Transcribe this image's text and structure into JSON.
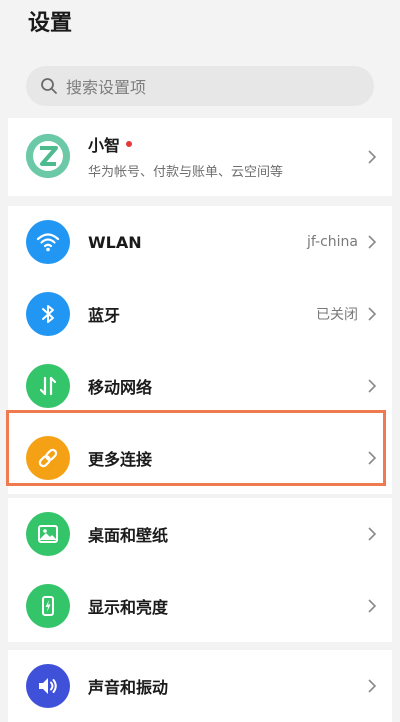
{
  "page": {
    "title": "设置"
  },
  "search": {
    "placeholder": "搜索设置项"
  },
  "account": {
    "name": "小智",
    "subtitle": "华为帐号、付款与账单、云空间等",
    "avatar_color": "#6cc9a8"
  },
  "network_group": [
    {
      "id": "wlan",
      "label": "WLAN",
      "value": "jf-china",
      "icon": "wifi-icon",
      "color": "#2196f3"
    },
    {
      "id": "bluetooth",
      "label": "蓝牙",
      "value": "已关闭",
      "icon": "bluetooth-icon",
      "color": "#2196f3"
    },
    {
      "id": "mobile-network",
      "label": "移动网络",
      "value": "",
      "icon": "mobile-data-icon",
      "color": "#34c46a"
    },
    {
      "id": "more-connections",
      "label": "更多连接",
      "value": "",
      "icon": "link-icon",
      "color": "#f5a116",
      "highlighted": true
    }
  ],
  "display_group": [
    {
      "id": "wallpaper",
      "label": "桌面和壁纸",
      "icon": "wallpaper-icon",
      "color": "#34c46a"
    },
    {
      "id": "display",
      "label": "显示和亮度",
      "icon": "phone-brightness-icon",
      "color": "#34c46a"
    }
  ],
  "sound_group": [
    {
      "id": "sound",
      "label": "声音和振动",
      "icon": "speaker-icon",
      "color": "#3f51d8"
    }
  ],
  "colors": {
    "highlight_border": "#ef7a4f",
    "notification_dot": "#e53935"
  }
}
